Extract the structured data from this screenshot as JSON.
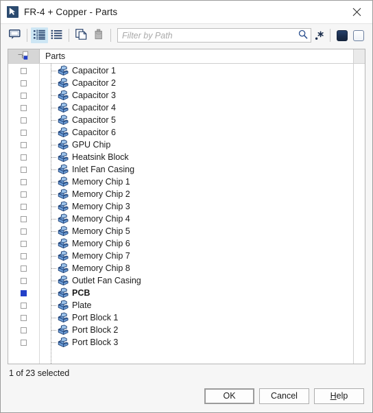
{
  "window": {
    "title": "FR-4 + Copper - Parts",
    "app_icon": "cursor-arrow-icon",
    "close_label": "close-icon"
  },
  "toolbar": {
    "comment_icon": "speech-bubble-icon",
    "list_detail_icon": "list-with-markers-icon",
    "list_plain_icon": "list-icon",
    "copy_icon": "copy-icon",
    "paste_icon": "paste-icon",
    "search_icon": "magnifier-icon",
    "regex_label": ".*",
    "swatch_dark": "dark-square-icon",
    "swatch_light": "light-square-icon",
    "swatch_dark_color": "#1b2e4d",
    "swatch_light_color": "#eef2f7"
  },
  "filter": {
    "value": "",
    "placeholder": "Filter by Path"
  },
  "tree": {
    "header_check_icon": "hierarchy-select-icon",
    "header_label": "Parts",
    "selection_color": "#2340c8",
    "items": [
      {
        "label": "Capacitor 1",
        "checked": false
      },
      {
        "label": "Capacitor 2",
        "checked": false
      },
      {
        "label": "Capacitor 3",
        "checked": false
      },
      {
        "label": "Capacitor 4",
        "checked": false
      },
      {
        "label": "Capacitor 5",
        "checked": false
      },
      {
        "label": "Capacitor 6",
        "checked": false
      },
      {
        "label": "GPU Chip",
        "checked": false
      },
      {
        "label": "Heatsink Block",
        "checked": false
      },
      {
        "label": "Inlet Fan Casing",
        "checked": false
      },
      {
        "label": "Memory Chip 1",
        "checked": false
      },
      {
        "label": "Memory Chip 2",
        "checked": false
      },
      {
        "label": "Memory Chip 3",
        "checked": false
      },
      {
        "label": "Memory Chip 4",
        "checked": false
      },
      {
        "label": "Memory Chip 5",
        "checked": false
      },
      {
        "label": "Memory Chip 6",
        "checked": false
      },
      {
        "label": "Memory Chip 7",
        "checked": false
      },
      {
        "label": "Memory Chip 8",
        "checked": false
      },
      {
        "label": "Outlet Fan Casing",
        "checked": false
      },
      {
        "label": "PCB",
        "checked": true
      },
      {
        "label": "Plate",
        "checked": false
      },
      {
        "label": "Port Block 1",
        "checked": false
      },
      {
        "label": "Port Block 2",
        "checked": false
      },
      {
        "label": "Port Block 3",
        "checked": false
      }
    ]
  },
  "status": {
    "text": "1 of 23 selected"
  },
  "buttons": {
    "ok": "OK",
    "cancel": "Cancel",
    "help_prefix": "H",
    "help_rest": "elp"
  }
}
